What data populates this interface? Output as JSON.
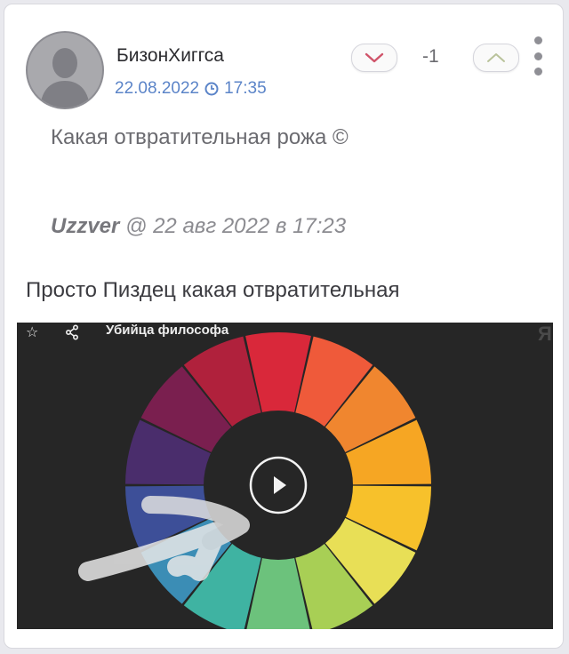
{
  "post": {
    "username": "БизонХиггса",
    "date": "22.08.2022",
    "time": "17:35",
    "score": "-1",
    "text": "Какая отвратительная рожа ©"
  },
  "quote": {
    "author": "Uzzver",
    "meta": " @ 22 авг 2022 в 17:23"
  },
  "reply": {
    "text": "Просто Пиздец какая отвратительная"
  },
  "video": {
    "title": "Убийца философа",
    "brand": "Я"
  },
  "icons": {
    "avatar": "user-silhouette-icon",
    "clock": "clock-icon",
    "down": "chevron-down-icon",
    "up": "chevron-up-icon",
    "more": "more-vertical-icon",
    "star": "star-icon",
    "share": "share-icon",
    "play": "play-icon"
  },
  "colors": {
    "accent_blue": "#5b84c8",
    "downvote": "#d0546a",
    "upvote": "#b9c29a"
  }
}
